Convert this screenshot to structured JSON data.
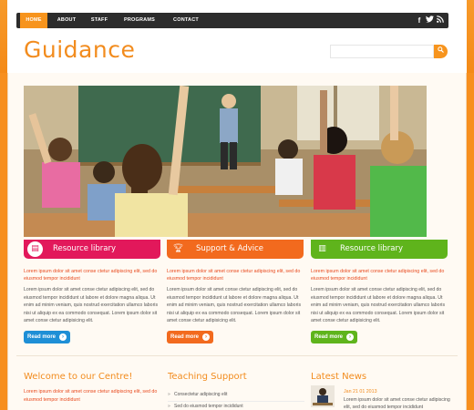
{
  "nav": {
    "items": [
      "HOME",
      "ABOUT",
      "STAFF",
      "PROGRAMS",
      "CONTACT"
    ],
    "social": [
      "facebook-icon",
      "twitter-icon",
      "rss-icon"
    ]
  },
  "site": {
    "logo": "Guidance"
  },
  "search": {
    "placeholder": "",
    "button": "⚲"
  },
  "features": [
    {
      "title": "Resource library",
      "color": "#e2185b",
      "icon": "book-icon",
      "lead": "Lorem ipsum dolor sit amet conse ctetur adipiscing elit, sed do eiusmod tempor incididunt",
      "body": "Lorem ipsum dolor sit amet conse ctetur adipiscing elit, sed do eiusmod tempor incididunt ut labore et dolore magna aliqua. Ut enim ad minim veniam, quis nostrud exercitation ullamco laboris nisi ut aliquip ex ea commodo consequat. Lorem ipsum dolor sit amet conse ctetur adipisicing elit.",
      "button": "Read more",
      "button_color": "#1e8fd6"
    },
    {
      "title": "Support & Advice",
      "color": "#f26a1e",
      "icon": "trophy-icon",
      "lead": "Lorem ipsum dolor sit amet conse ctetur adipiscing elit, sed do eiusmod tempor incididunt",
      "body": "Lorem ipsum dolor sit amet conse ctetur adipiscing elit, sed do eiusmod tempor incididunt ut labore et dolore magna aliqua. Ut enim ad minim veniam, quis nostrud exercitation ullamco laboris nisi ut aliquip ex ea commodo consequat. Lorem ipsum dolor sit amet conse ctetur adipisicing elit.",
      "button": "Read more",
      "button_color": "#f26a1e"
    },
    {
      "title": "Resource library",
      "color": "#5fb41c",
      "icon": "books-icon",
      "lead": "Lorem ipsum dolor sit amet conse ctetur adipiscing elit, sed do eiusmod tempor incididunt",
      "body": "Lorem ipsum dolor sit amet conse ctetur adipiscing elit, sed do eiusmod tempor incididunt ut labore et dolore magna aliqua. Ut enim ad minim veniam, quis nostrud exercitation ullamco laboris nisi ut aliquip ex ea commodo consequat. Lorem ipsum dolor sit amet conse ctetur adipisicing elit.",
      "button": "Read more",
      "button_color": "#5fb41c"
    }
  ],
  "welcome": {
    "title": "Welcome to our Centre!",
    "lead": "Lorem ipsum dolor sit amet conse ctetur adipiscing elit, sed do eiusmod tempor incididunt"
  },
  "teaching": {
    "title": "Teaching Support",
    "items": [
      "Consectetur adipiscing elit",
      "Sed do eiusmod tempor incididunt"
    ]
  },
  "news": {
    "title": "Latest News",
    "date": "Jan 21 01 2013",
    "text": "Lorem ipsum dolor sit amet conse ctetur adipiscing elit, sed do eiusmod tempor incididunt"
  }
}
